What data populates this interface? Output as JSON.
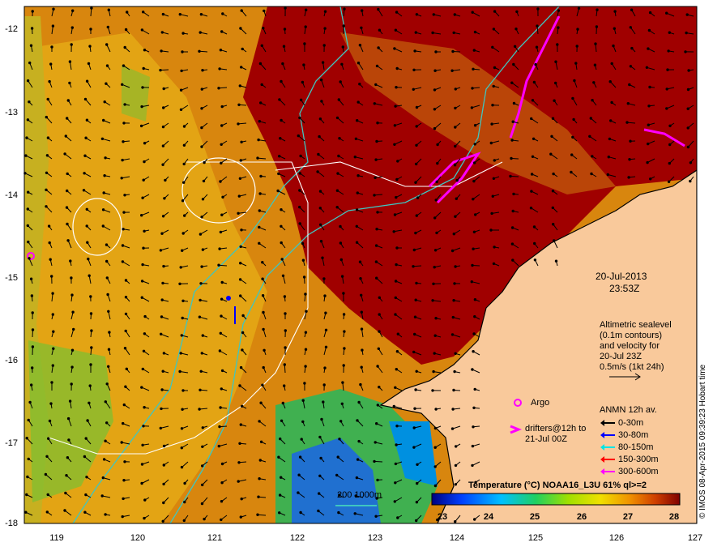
{
  "date": "20-Jul-2013",
  "time": "23:53Z",
  "altimetry_note": [
    "Altimetric sealevel",
    "(0.1m contours)",
    "and velocity for",
    "20-Jul 23Z",
    "0.5m/s (1kt 24h)"
  ],
  "argo_label": "Argo",
  "drifters_label": [
    "drifters@12h to",
    "21-Jul 00Z"
  ],
  "anmn_title": "ANMN 12h av.",
  "anmn_items": [
    {
      "label": "0-30m",
      "color": "#000000"
    },
    {
      "label": "30-80m",
      "color": "#0000ff"
    },
    {
      "label": "80-150m",
      "color": "#00e5e5"
    },
    {
      "label": "150-300m",
      "color": "#ff0000"
    },
    {
      "label": "300-600m",
      "color": "#ff00ff"
    }
  ],
  "isobath_label": "200  1000m",
  "colorbar_title": "Temperature (°C) NOAA16_L3U 61% ql>=2",
  "colorbar_ticks": [
    "23",
    "24",
    "25",
    "26",
    "27",
    "28"
  ],
  "y_ticks": [
    "-12",
    "-13",
    "-14",
    "-15",
    "-16",
    "-17",
    "-18"
  ],
  "x_ticks": [
    "119",
    "120",
    "121",
    "122",
    "123",
    "124",
    "125",
    "126",
    "127"
  ],
  "credit": "© IMOS 08-Apr-2015 09:39:23 Hobart time",
  "colors": {
    "warm_red": "#a00000",
    "orange": "#d0700a",
    "yellow_orange": "#e8a010",
    "land": "#f9c99b",
    "shelf_contour": "#3fc6c0",
    "sealevel_contour": "#ffffff",
    "argo": "#ff00ff"
  }
}
